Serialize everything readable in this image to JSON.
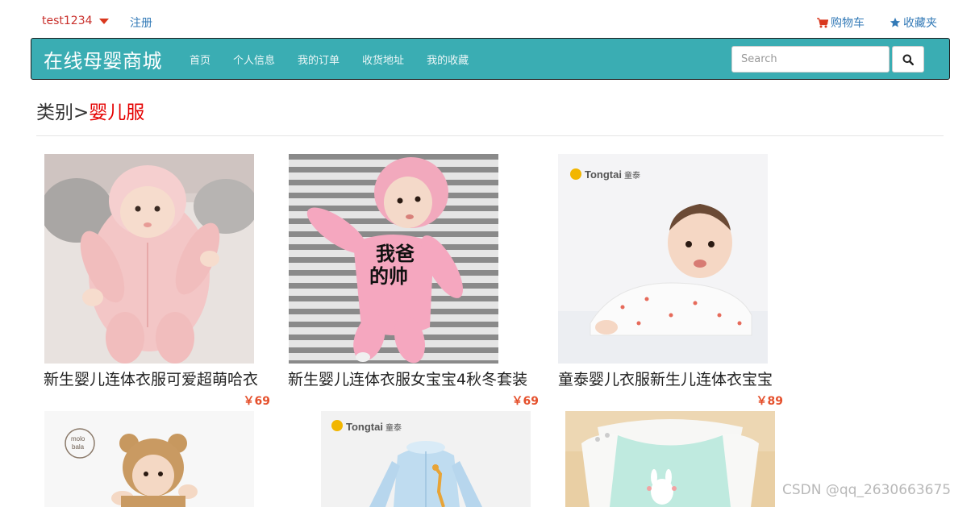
{
  "topbar": {
    "username": "test1234",
    "register": "注册",
    "cart": "购物车",
    "favorites": "收藏夹"
  },
  "navbar": {
    "brand": "在线母婴商城",
    "items": [
      "首页",
      "个人信息",
      "我的订单",
      "收货地址",
      "我的收藏"
    ],
    "search_placeholder": "Search"
  },
  "category": {
    "prefix": "类别",
    "separator": ">",
    "current": "婴儿服"
  },
  "products": [
    {
      "name": "新生婴儿连体衣服可爱超萌哈衣",
      "price": "￥69"
    },
    {
      "name": "新生婴儿连体衣服女宝宝4秋冬套装",
      "price": "￥69"
    },
    {
      "name": "童泰婴儿衣服新生儿连体衣宝宝",
      "price": "￥89"
    }
  ],
  "image_logos": {
    "tongtai": "Tongtai",
    "tongtai_cn": "童泰",
    "molobala": "molo bala",
    "shirt_text": "我爸",
    "shirt_text2": "的帅"
  },
  "watermark": "CSDN @qq_2630663675",
  "colors": {
    "navbar_bg": "#3aadb3",
    "price": "#e5502c",
    "category_current": "#e50000",
    "link": "#337ab7",
    "user": "#c9302c"
  }
}
